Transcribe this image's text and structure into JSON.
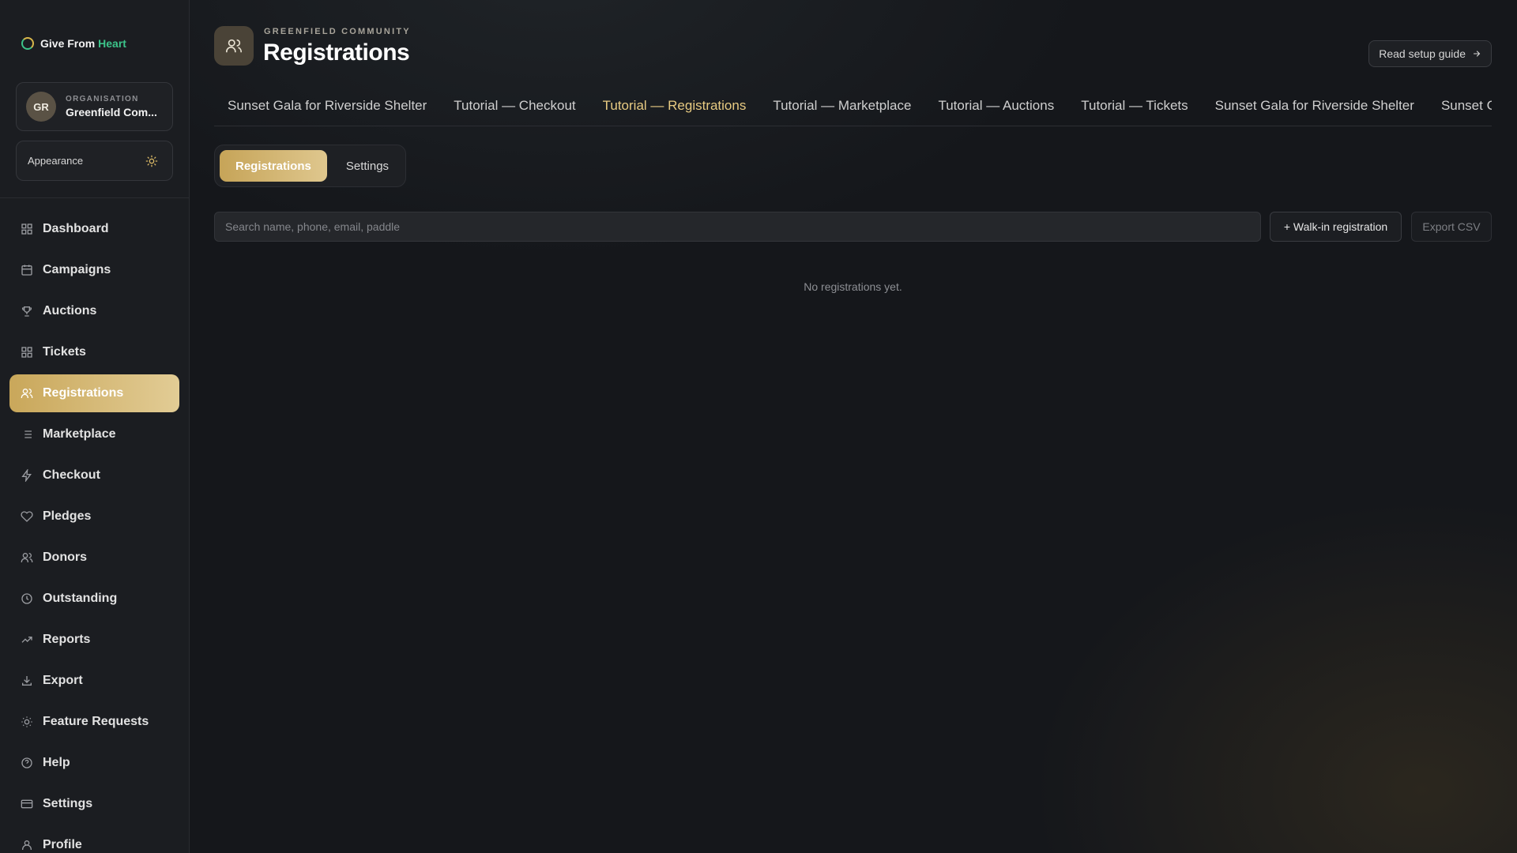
{
  "brand": {
    "name_main": "Give From",
    "name_accent": "Heart"
  },
  "org": {
    "initials": "GR",
    "label": "ORGANISATION",
    "name": "Greenfield Com..."
  },
  "appearance": {
    "label": "Appearance",
    "icon": "sun-icon"
  },
  "nav": [
    {
      "label": "Dashboard",
      "icon": "dashboard-icon"
    },
    {
      "label": "Campaigns",
      "icon": "calendar-icon"
    },
    {
      "label": "Auctions",
      "icon": "trophy-icon"
    },
    {
      "label": "Tickets",
      "icon": "grid-icon"
    },
    {
      "label": "Registrations",
      "icon": "users-icon",
      "active": true
    },
    {
      "label": "Marketplace",
      "icon": "list-icon"
    },
    {
      "label": "Checkout",
      "icon": "bolt-icon"
    },
    {
      "label": "Pledges",
      "icon": "heart-icon"
    },
    {
      "label": "Donors",
      "icon": "users-icon"
    },
    {
      "label": "Outstanding",
      "icon": "clock-icon"
    },
    {
      "label": "Reports",
      "icon": "trending-up-icon"
    },
    {
      "label": "Export",
      "icon": "download-icon"
    },
    {
      "label": "Feature Requests",
      "icon": "sun-icon"
    },
    {
      "label": "Help",
      "icon": "help-icon"
    },
    {
      "label": "Settings",
      "icon": "card-icon"
    },
    {
      "label": "Profile",
      "icon": "user-icon"
    }
  ],
  "header": {
    "eyebrow": "GREENFIELD COMMUNITY",
    "title": "Registrations",
    "guide_label": "Read setup guide"
  },
  "tabs": [
    {
      "label": "Sunset Gala for Riverside Shelter"
    },
    {
      "label": "Tutorial — Checkout"
    },
    {
      "label": "Tutorial — Registrations",
      "active": true
    },
    {
      "label": "Tutorial — Marketplace"
    },
    {
      "label": "Tutorial — Auctions"
    },
    {
      "label": "Tutorial — Tickets"
    },
    {
      "label": "Sunset Gala for Riverside Shelter"
    },
    {
      "label": "Sunset Gala for Riverside Shelter"
    }
  ],
  "segments": {
    "registrations": "Registrations",
    "settings": "Settings"
  },
  "toolbar": {
    "search_placeholder": "Search name, phone, email, paddle",
    "search_value": "",
    "walkin_label": "+ Walk-in registration",
    "export_label": "Export CSV"
  },
  "empty_message": "No registrations yet.",
  "colors": {
    "accent_gold": "#d9b765",
    "brand_green": "#3cc48a",
    "background": "#15171b"
  }
}
